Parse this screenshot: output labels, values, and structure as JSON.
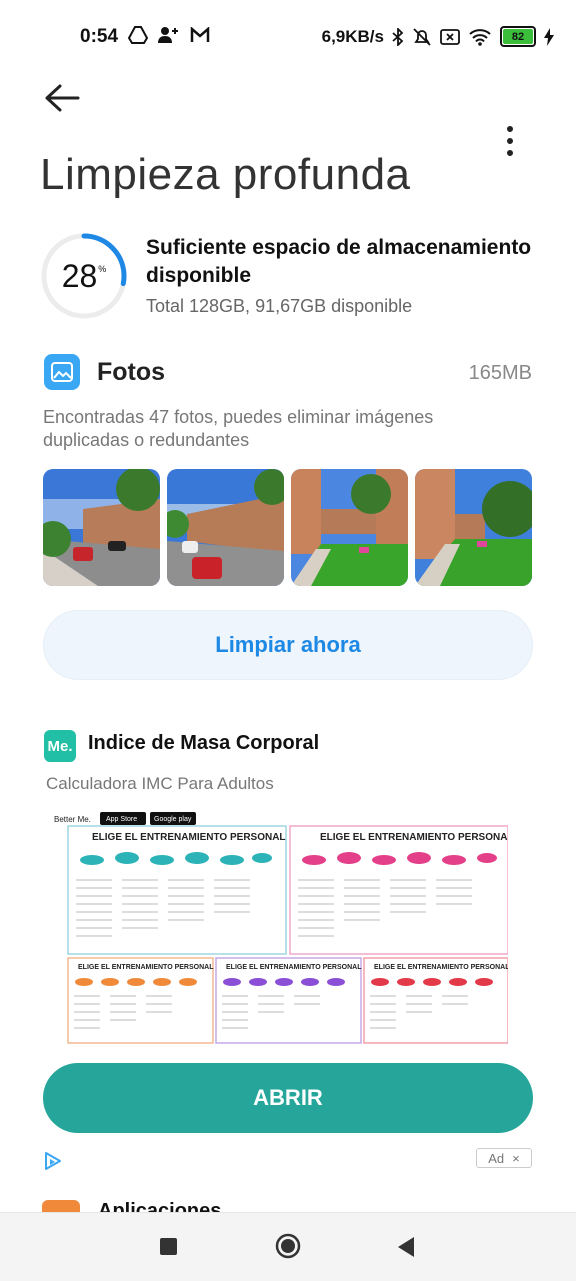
{
  "status_bar": {
    "time": "0:54",
    "network_speed": "6,9KB/s",
    "battery_level": "82",
    "icons": [
      "drive-icon",
      "add-person-icon",
      "gmail-icon",
      "bluetooth-icon",
      "mute-icon",
      "sim-icon",
      "wifi-icon",
      "battery-icon",
      "charging-icon"
    ]
  },
  "header": {
    "title": "Limpieza profunda"
  },
  "storage": {
    "percent": "28",
    "percent_sign": "%",
    "percent_value": 28,
    "title": "Suficiente espacio de almacenamiento disponible",
    "subtitle": "Total 128GB, 91,67GB disponible",
    "accent_color": "#1e88e5"
  },
  "photos": {
    "title": "Fotos",
    "size": "165MB",
    "description": "Encontradas 47 fotos, puedes eliminar imágenes duplicadas o redundantes",
    "thumbnails": [
      "street-photo",
      "street-photo",
      "garden-photo",
      "garden-photo"
    ],
    "button_label": "Limpiar ahora"
  },
  "ad": {
    "logo_text": "Me.",
    "title": "Indice de Masa Corporal",
    "subtitle": "Calculadora IMC Para Adultos",
    "image": {
      "brand": "Better Me.",
      "store_badges": [
        "App Store",
        "Google play"
      ],
      "panel_heading": "ELIGE EL ENTRENAMIENTO PERSONAL"
    },
    "button_label": "ABRIR",
    "badge_label": "Ad",
    "badge_close": "×",
    "accent_color": "#26a69a"
  },
  "next_section": {
    "label": "Aplicaciones"
  }
}
